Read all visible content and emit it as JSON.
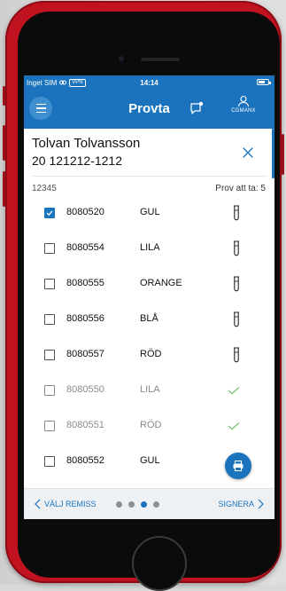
{
  "statusbar": {
    "carrier": "Inget SIM",
    "vpn": "VPN",
    "time": "14:14",
    "battery_level": 0.7
  },
  "navbar": {
    "title": "Provta",
    "user_label": "CGMANX"
  },
  "patient": {
    "name": "Tolvan Tolvansson",
    "id": "20 121212-1212"
  },
  "meta": {
    "remiss_number": "12345",
    "samples_to_take": "Prov att ta: 5"
  },
  "samples": [
    {
      "number": "8080520",
      "color": "GUL",
      "checked": true,
      "status": "tube-icon"
    },
    {
      "number": "8080554",
      "color": "LILA",
      "checked": false,
      "status": "tube-icon"
    },
    {
      "number": "8080555",
      "color": "ORANGE",
      "checked": false,
      "status": "tube-icon"
    },
    {
      "number": "8080556",
      "color": "BLÅ",
      "checked": false,
      "status": "tube-icon"
    },
    {
      "number": "8080557",
      "color": "RÖD",
      "checked": false,
      "status": "tube-icon"
    },
    {
      "number": "8080550",
      "color": "LILA",
      "checked": false,
      "status": "check-icon"
    },
    {
      "number": "8080551",
      "color": "RÖD",
      "checked": false,
      "status": "check-icon"
    },
    {
      "number": "8080552",
      "color": "GUL",
      "checked": false,
      "status": "none"
    }
  ],
  "bottombar": {
    "back_label": "VÄLJ REMISS",
    "next_label": "SIGNERA",
    "page_count": 4,
    "active_page": 3
  },
  "colors": {
    "primary": "#1a73bc",
    "check": "#5cb85c",
    "phone_red": "#c1121f"
  }
}
